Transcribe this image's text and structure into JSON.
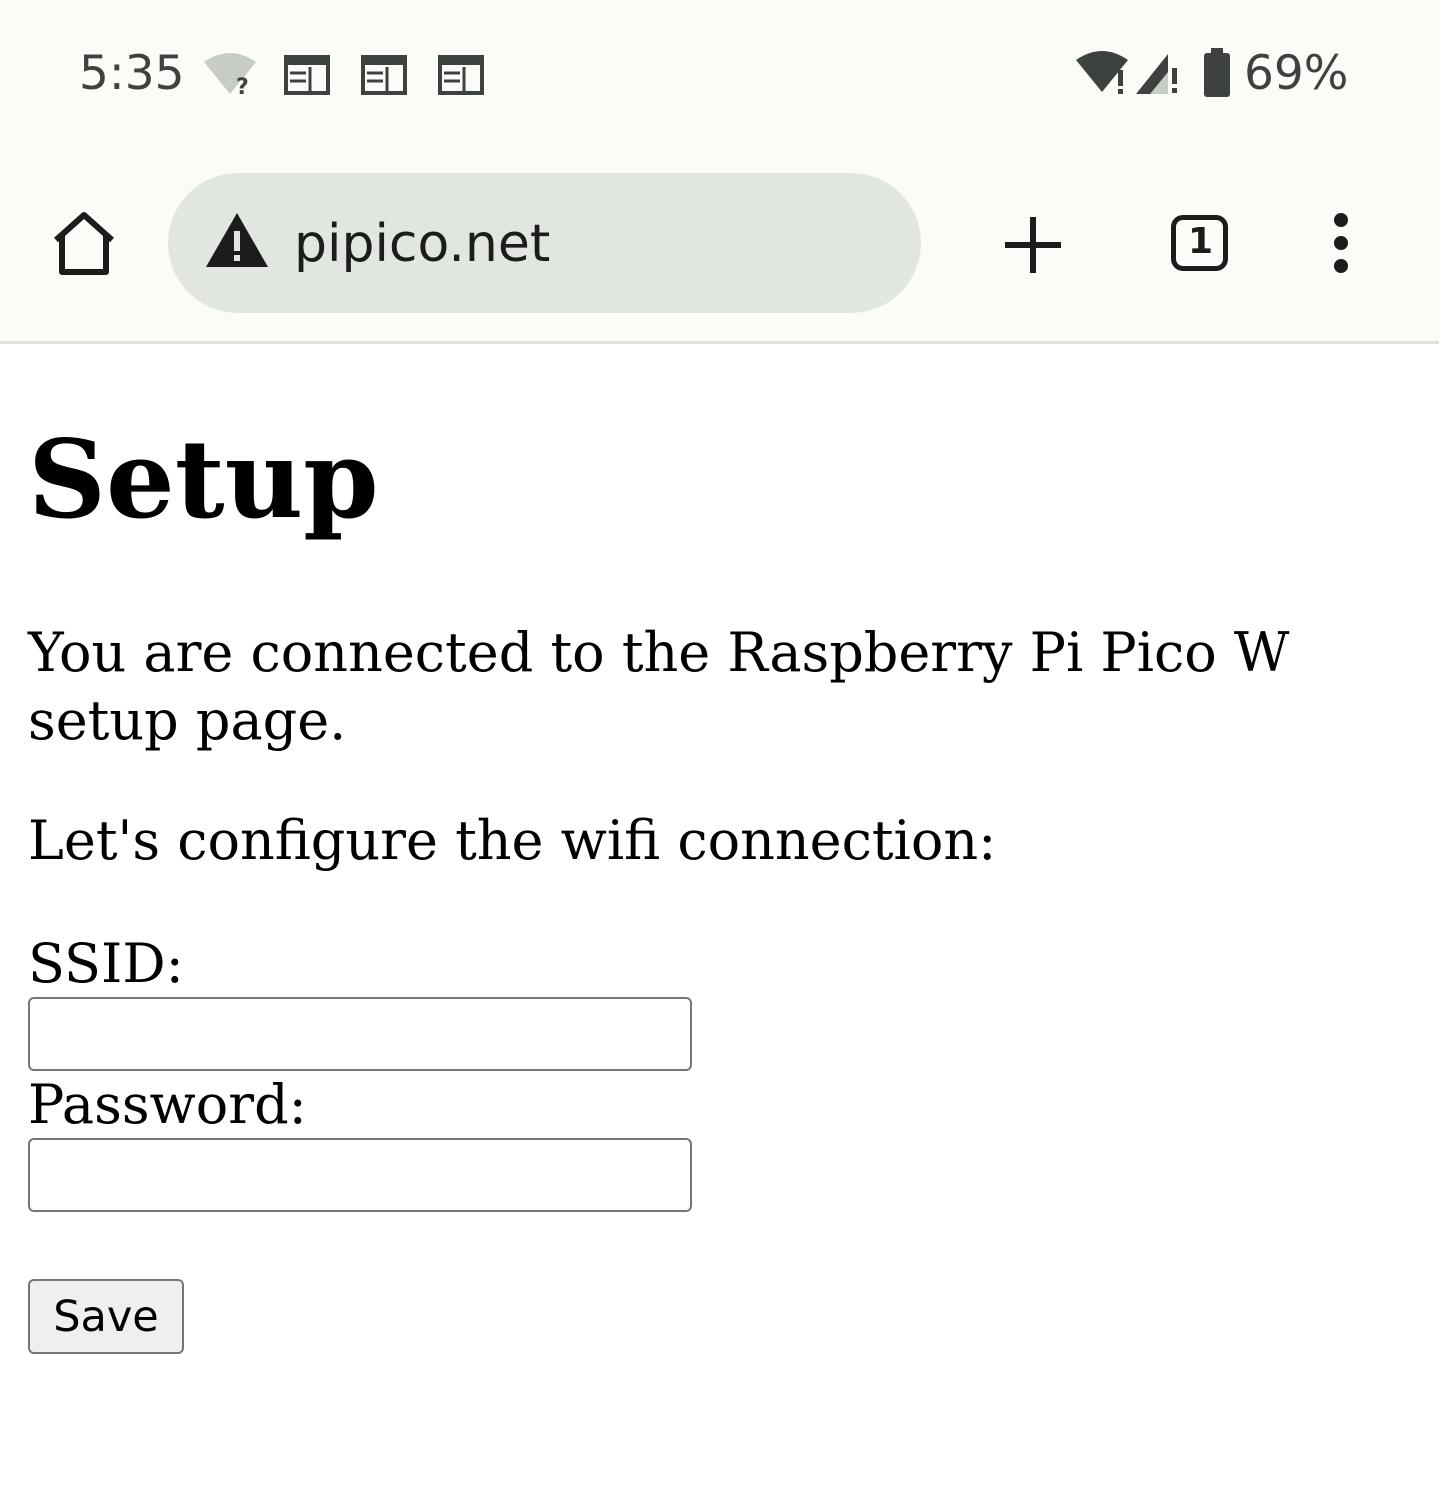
{
  "status_bar": {
    "time": "5:35",
    "battery": "69%",
    "icons": [
      "wifi-unknown-icon",
      "calendar-icon",
      "calendar-icon",
      "calendar-icon",
      "wifi-alert-icon",
      "signal-alert-icon",
      "battery-icon"
    ]
  },
  "browser": {
    "url": "pipico.net",
    "tab_count": "1",
    "icons": [
      "home-icon",
      "warning-icon",
      "new-tab-icon",
      "tab-switcher-icon",
      "more-menu-icon"
    ]
  },
  "page": {
    "title": "Setup",
    "intro": "You are connected to the Raspberry Pi Pico W setup page.",
    "prompt": "Let's configure the wifi connection:",
    "ssid_label": "SSID:",
    "ssid_value": "",
    "password_label": "Password:",
    "password_value": "",
    "save_label": "Save"
  }
}
